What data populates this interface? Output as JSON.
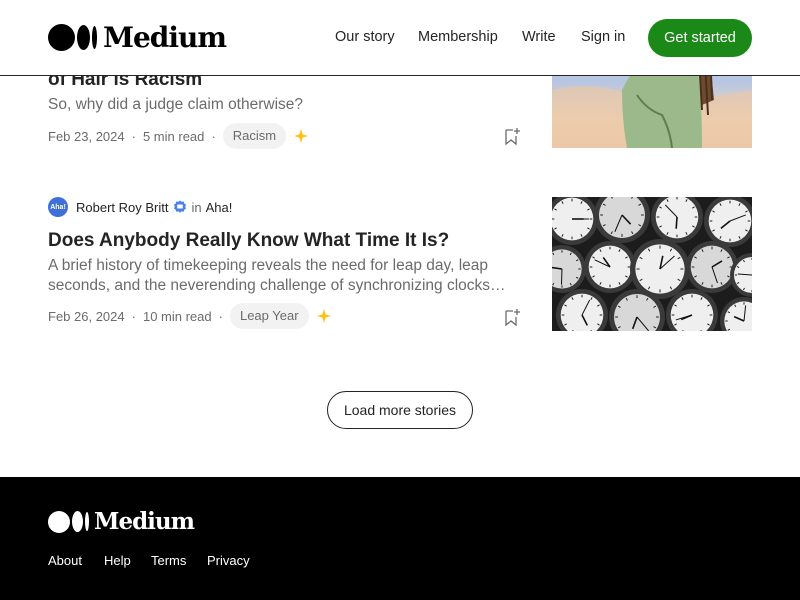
{
  "header": {
    "logo_text": "Medium",
    "nav": {
      "our_story": "Our story",
      "membership": "Membership",
      "write": "Write",
      "sign_in": "Sign in"
    },
    "cta": "Get started"
  },
  "articles": [
    {
      "title": "of Hair is Racism",
      "subtitle": "So, why did a judge claim otherwise?",
      "date": "Feb 23, 2024",
      "read_time": "5 min read",
      "tag": "Racism",
      "member_only_icon": "sparkle-icon",
      "bookmark_icon": "bookmark-add-icon"
    },
    {
      "author": "Robert Roy Britt",
      "avatar_text": "Aha!",
      "in_label": "in",
      "publication": "Aha!",
      "title": "Does Anybody Really Know What Time It Is?",
      "subtitle_line1": "A brief history of timekeeping reveals the need for leap day, leap",
      "subtitle_line2": "seconds, and the neverending challenge of synchronizing clocks…",
      "date": "Feb 26, 2024",
      "read_time": "10 min read",
      "tag": "Leap Year",
      "member_only_icon": "sparkle-icon",
      "bookmark_icon": "bookmark-add-icon"
    }
  ],
  "load_more": "Load more stories",
  "footer": {
    "logo_text": "Medium",
    "links": {
      "about": "About",
      "help": "Help",
      "terms": "Terms",
      "privacy": "Privacy"
    }
  },
  "colors": {
    "brand_green": "#1a8917",
    "text": "#242424",
    "muted": "#6b6b6b",
    "sparkle": "#ffc017",
    "footer_bg": "#000000"
  }
}
